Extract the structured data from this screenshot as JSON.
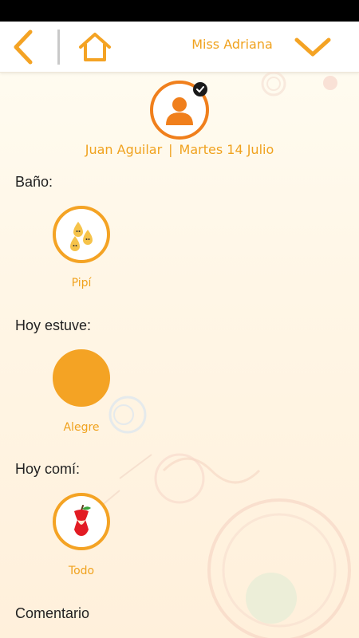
{
  "header": {
    "teacher_name": "Miss Adriana"
  },
  "student": {
    "name": "Juan Aguilar",
    "separator": "|",
    "date": "Martes 14 Julio"
  },
  "sections": {
    "bano": {
      "label": "Baño:",
      "value": "Pipí"
    },
    "animo": {
      "label": "Hoy estuve:",
      "value": "Alegre"
    },
    "comida": {
      "label": "Hoy comí:",
      "value": "Todo"
    },
    "comentario": {
      "label": "Comentario"
    }
  },
  "colors": {
    "accent": "#f4a324",
    "avatar": "#f07f1c",
    "text": "#222222"
  }
}
